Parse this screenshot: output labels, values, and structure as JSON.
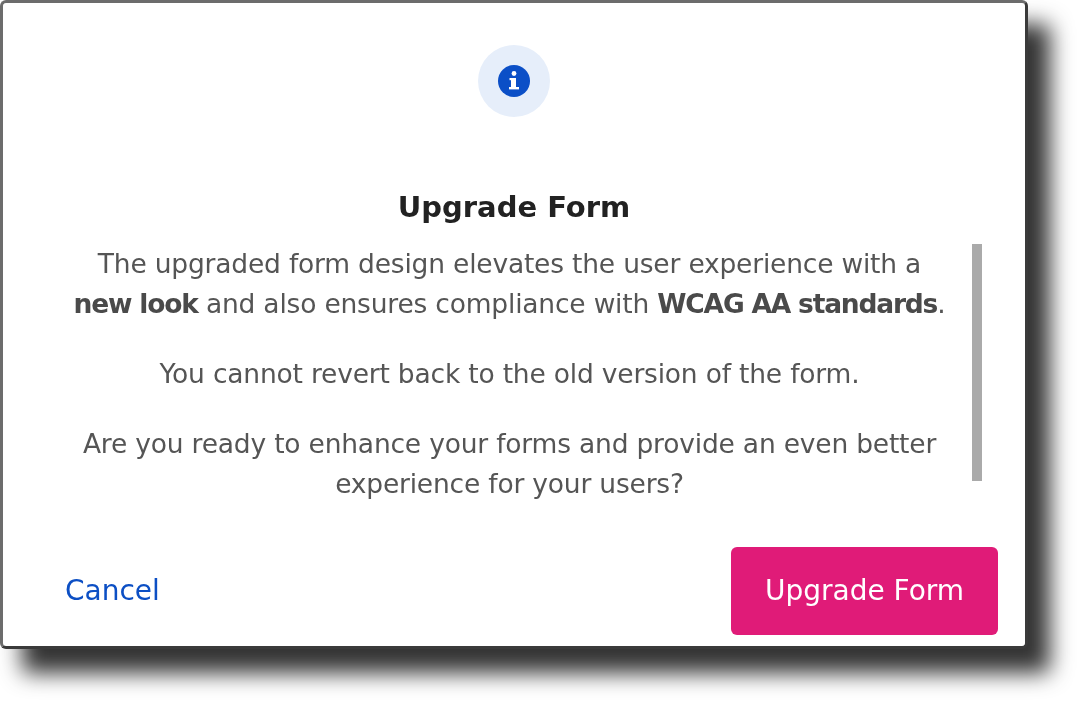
{
  "dialog": {
    "title": "Upgrade Form",
    "paragraphs": [
      "The upgraded form design elevates the user experience with a **new look** and also ensures compliance with **WCAG AA standards**.",
      "You cannot revert back to the old version of the form.",
      "Are you ready to enhance your forms and provide an even better experience for your users?"
    ],
    "buttons": [
      {
        "label": "Cancel",
        "kind": "link"
      },
      {
        "label": "Upgrade Form",
        "kind": "primary"
      }
    ]
  }
}
